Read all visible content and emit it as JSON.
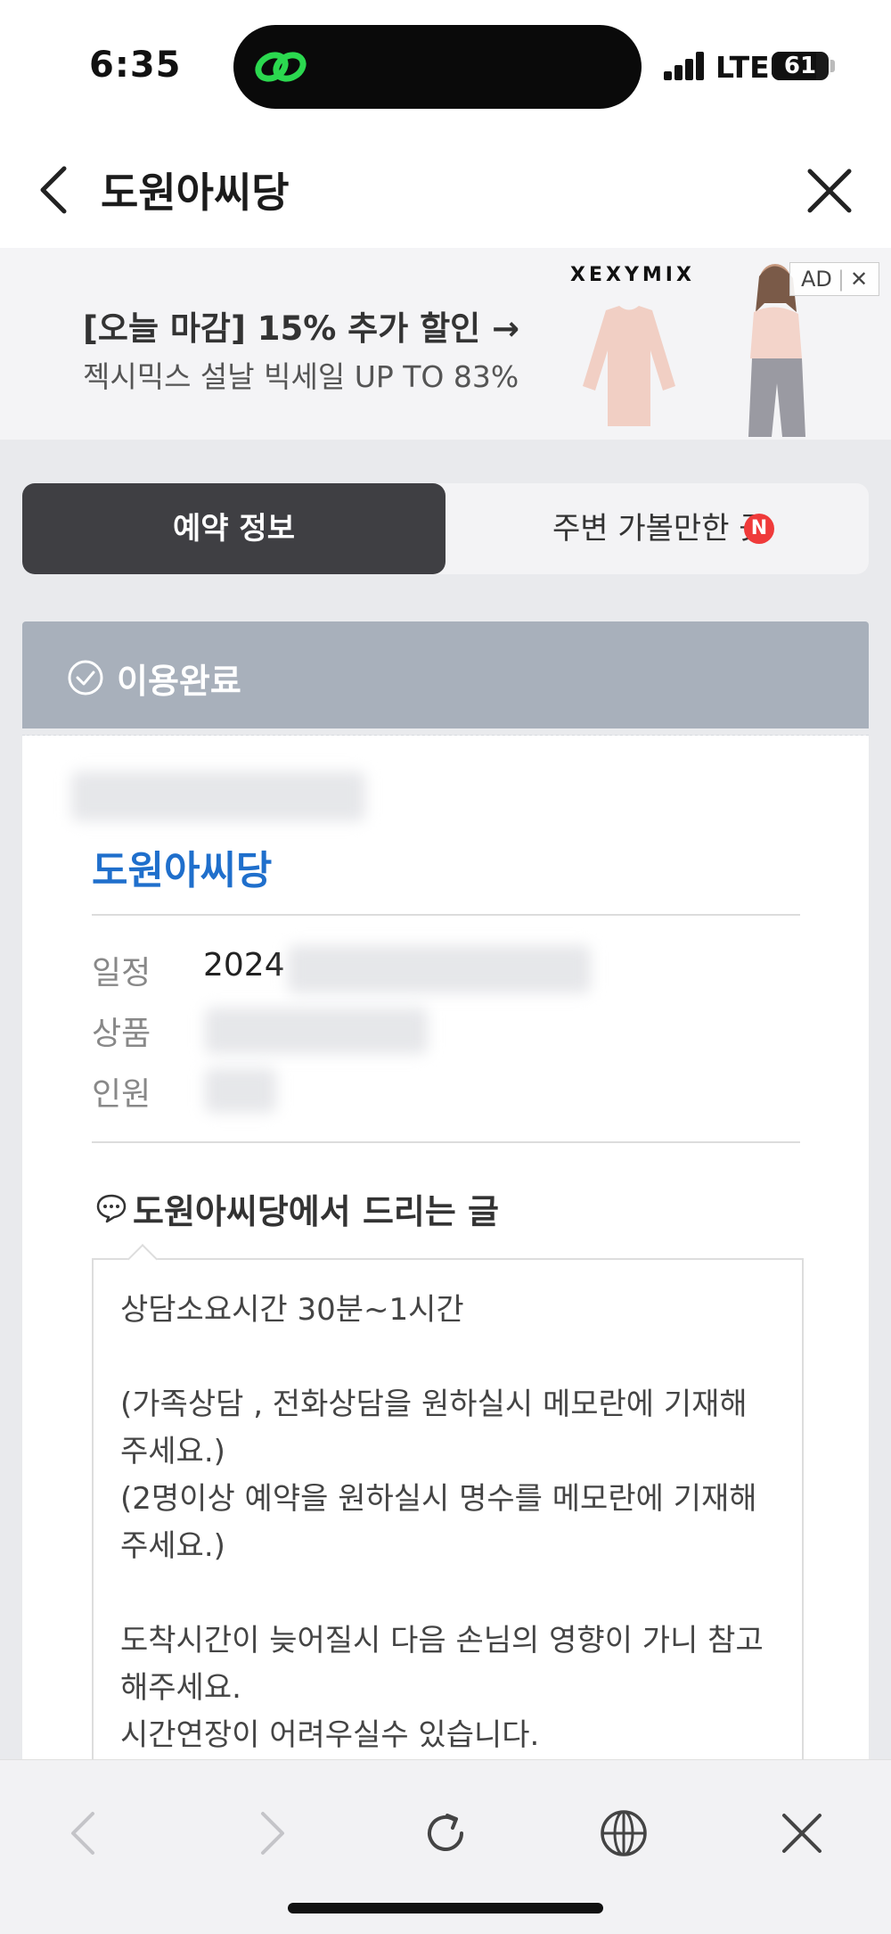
{
  "status_bar": {
    "time": "6:35",
    "network": "LTE",
    "battery": "61"
  },
  "header": {
    "title": "도원아씨당"
  },
  "ad": {
    "title": "[오늘 마감] 15% 추가 할인 →",
    "subtitle": "젝시믹스 설날 빅세일 UP TO 83%",
    "brand": "XEXYMIX",
    "label": "AD"
  },
  "tabs": [
    {
      "label": "예약 정보",
      "active": true
    },
    {
      "label": "주변 가볼만한 곳",
      "badge": "N",
      "active": false
    }
  ],
  "reservation": {
    "status": "이용완료",
    "place_name": "도원아씨당",
    "rows": [
      {
        "label": "일정",
        "value": "2024"
      },
      {
        "label": "상품",
        "value": ""
      },
      {
        "label": "인원",
        "value": ""
      }
    ]
  },
  "message": {
    "title": "도원아씨당에서 드리는 글",
    "lines": [
      "상담소요시간 30분~1시간",
      "",
      "(가족상담 , 전화상담을 원하실시 메모란에 기재해",
      "주세요.)",
      "(2명이상 예약을 원하실시 명수를 메모란에 기재해",
      "주세요.)",
      "",
      "도착시간이 늦어질시 다음 손님의 영향이 가니 참고",
      "해주세요.",
      "시간연장이 어려우실수 있습니다."
    ]
  },
  "icons": {
    "back": "chevron-left-icon",
    "close": "close-icon",
    "status": "check-circle-icon",
    "message": "speech-bubble-icon",
    "browser_back": "chevron-left-icon",
    "browser_forward": "chevron-right-icon",
    "browser_reload": "reload-icon",
    "browser_globe": "globe-icon",
    "browser_close": "close-icon"
  },
  "colors": {
    "accent_blue": "#1f6fcc",
    "tab_active": "#3f3f43",
    "status_card": "#a8b0bb",
    "badge_red": "#ef3a3a"
  }
}
